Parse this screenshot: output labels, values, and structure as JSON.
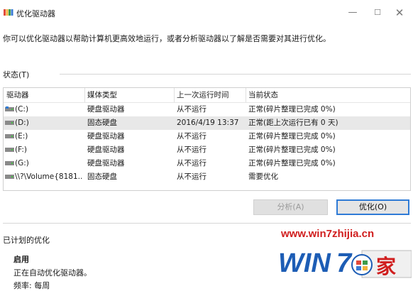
{
  "window": {
    "title": "优化驱动器",
    "description": "你可以优化驱动器以帮助计算机更高效地运行，或者分析驱动器以了解是否需要对其进行优化。",
    "controls": {
      "minimize": "—",
      "maximize": "☐",
      "close": "✕"
    }
  },
  "status_section": {
    "label": "状态(T)",
    "columns": [
      "驱动器",
      "媒体类型",
      "上一次运行时间",
      "当前状态"
    ],
    "rows": [
      {
        "drive": "(C:)",
        "icon": "system-drive-icon",
        "media": "硬盘驱动器",
        "last_run": "从不运行",
        "status": "正常(碎片整理已完成 0%)"
      },
      {
        "drive": "(D:)",
        "icon": "drive-icon",
        "media": "固态硬盘",
        "last_run": "2016/4/19 13:37",
        "status": "正常(距上次运行已有 0 天)"
      },
      {
        "drive": "(E:)",
        "icon": "drive-icon",
        "media": "硬盘驱动器",
        "last_run": "从不运行",
        "status": "正常(碎片整理已完成 0%)"
      },
      {
        "drive": "(F:)",
        "icon": "drive-icon",
        "media": "硬盘驱动器",
        "last_run": "从不运行",
        "status": "正常(碎片整理已完成 0%)"
      },
      {
        "drive": "(G:)",
        "icon": "drive-icon",
        "media": "硬盘驱动器",
        "last_run": "从不运行",
        "status": "正常(碎片整理已完成 0%)"
      },
      {
        "drive": "\\\\?\\Volume{8181...",
        "icon": "drive-icon",
        "media": "固态硬盘",
        "last_run": "从不运行",
        "status": "需要优化"
      }
    ],
    "selected_row": 1
  },
  "buttons": {
    "analyze": "分析(A)",
    "optimize": "优化(O)"
  },
  "scheduled": {
    "label": "已计划的优化",
    "status": "启用",
    "description": "正在自动优化驱动器。",
    "frequency": "频率: 每周"
  },
  "watermark": {
    "url": "www.win7zhijia.cn",
    "logo_text": "WIN7之家"
  },
  "colors": {
    "accent": "#2f7bd6",
    "watermark_red": "#d01e1e",
    "watermark_blue": "#1d5db5"
  }
}
